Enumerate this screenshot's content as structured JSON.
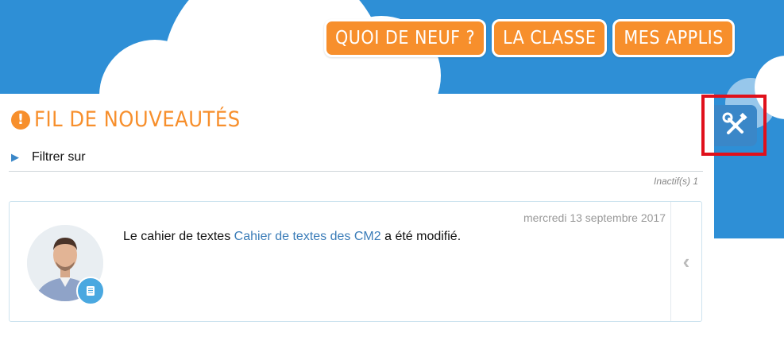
{
  "nav": {
    "whats_new": "QUOI DE NEUF ?",
    "class": "LA CLASSE",
    "apps": "MES APPLIS"
  },
  "page": {
    "title": "FIL DE NOUVEAUTÉS",
    "title_icon": "!"
  },
  "filter": {
    "label": "Filtrer sur"
  },
  "status": {
    "inactive": "Inactif(s) 1"
  },
  "feed": {
    "items": [
      {
        "date": "mercredi 13 septembre 2017",
        "text_before": "Le cahier de textes",
        "link": "Cahier de textes des CM2",
        "text_after": "a été modifié.",
        "app_icon": "notebook-icon"
      }
    ]
  },
  "icons": {
    "tools": "tools-icon",
    "collapse": "chevron-left-icon",
    "filter": "triangle-right-icon"
  },
  "colors": {
    "accent_orange": "#f78f2c",
    "sky_blue": "#2e8fd6",
    "link_blue": "#3a7cb8",
    "highlight_red": "#e0101b"
  }
}
